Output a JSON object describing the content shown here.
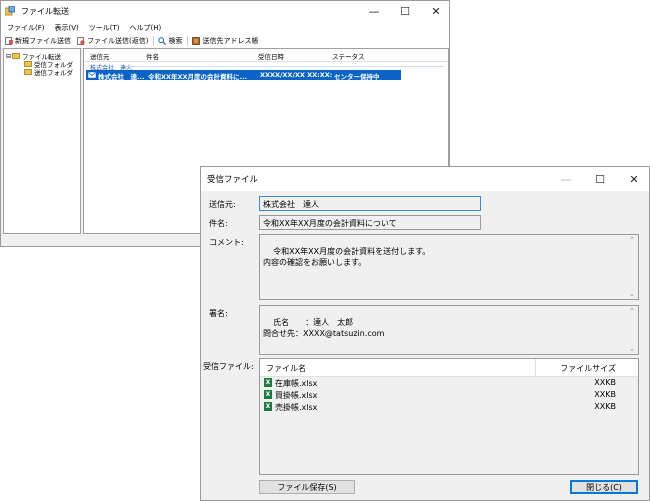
{
  "main_window": {
    "title": "ファイル転送",
    "controls": {
      "minimize": "—",
      "maximize": "☐",
      "close": "✕"
    },
    "menu": [
      "ファイル(F)",
      "表示(V)",
      "ツール(T)",
      "ヘルプ(H)"
    ],
    "toolbar": [
      "新規ファイル送信",
      "ファイル送信(返信)",
      "検索",
      "送信先アドレス帳"
    ],
    "tree": {
      "root": "ファイル転送",
      "children": [
        "受信フォルダ",
        "送信フォルダ"
      ]
    },
    "list": {
      "columns": [
        "送信元",
        "件名",
        "受信日時",
        "ステータス"
      ],
      "group": "株式会社　達人",
      "rows": [
        {
          "from": "株式会社　達...",
          "subject": "令和XX年XX月度の会計資料に...",
          "date": "XXXX/XX/XX XX:XX:XX",
          "status": "センター保持中"
        }
      ]
    }
  },
  "dialog": {
    "title": "受信ファイル",
    "controls": {
      "minimize": "—",
      "maximize": "☐",
      "close": "✕"
    },
    "sender_label": "送信元:",
    "sender_value": "株式会社　達人",
    "subject_label": "件名:",
    "subject_value": "令和XX年XX月度の会計資料について",
    "comment_label": "コメント:",
    "comment_value": "令和XX年XX月度の会計資料を送付します。\n内容の確認をお願いします。",
    "signature_label": "署名:",
    "signature_value": "氏名　　：達人　太郎\n問合せ先：XXXX@tatsuzin.com",
    "files_label": "受信ファイル:",
    "file_columns": {
      "name": "ファイル名",
      "size": "ファイルサイズ"
    },
    "files": [
      {
        "name": "在庫帳.xlsx",
        "size": "XXKB"
      },
      {
        "name": "買掛帳.xlsx",
        "size": "XXKB"
      },
      {
        "name": "売掛帳.xlsx",
        "size": "XXKB"
      }
    ],
    "save_button": "ファイル保存(S)",
    "close_button": "閉じる(C)",
    "scroll_up": "⌃",
    "scroll_down": "⌄"
  }
}
